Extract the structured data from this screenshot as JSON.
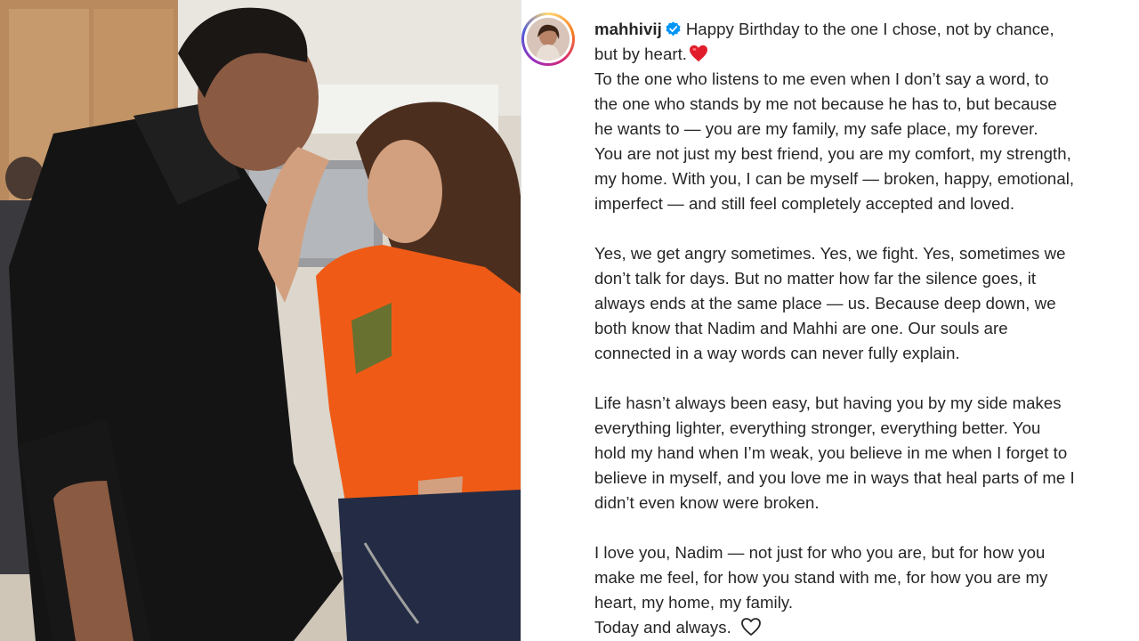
{
  "post": {
    "username": "mahhivij",
    "verified": true,
    "colors": {
      "text": "#262626",
      "verified": "#0095f6",
      "heart": "#e11d2b"
    },
    "icons": [
      "verified-badge-icon",
      "red-heart-emoji-icon",
      "outline-heart-icon"
    ],
    "caption": {
      "first_line": "Happy Birthday to the one I chose, not by chance,",
      "line2": "but by heart.",
      "line3": "To the one who listens to me even when I don’t say a word, to",
      "line4": "the one who stands by me not because he has to, but because",
      "line5": "he wants to — you are my family, my safe place, my forever.",
      "line6": "You are not just my best friend, you are my comfort, my strength,",
      "line7": "my home. With you, I can be myself — broken, happy, emotional,",
      "line8": "imperfect — and still feel completely accepted and loved.",
      "line9": "Yes, we get angry sometimes. Yes, we fight. Yes, sometimes we",
      "line10": "don’t talk for days. But no matter how far the silence goes, it",
      "line11": "always ends at the same place — us. Because deep down, we",
      "line12": "both know that Nadim and Mahhi are one. Our souls are",
      "line13": "connected in a way words can never fully explain.",
      "line14": "Life hasn’t always been easy, but having you by my side makes",
      "line15": "everything lighter, everything stronger, everything better. You",
      "line16": "hold my hand when I’m weak, you believe in me when I forget to",
      "line17": "believe in myself, and you love me in ways that heal parts of me I",
      "line18": "didn’t even know were broken.",
      "line19": "I love you, Nadim — not just for who you are, but for how you",
      "line20": "make me feel, for how you stand with me, for how you are my",
      "line21": "heart, my home, my family.",
      "line22": "Today and always."
    }
  }
}
